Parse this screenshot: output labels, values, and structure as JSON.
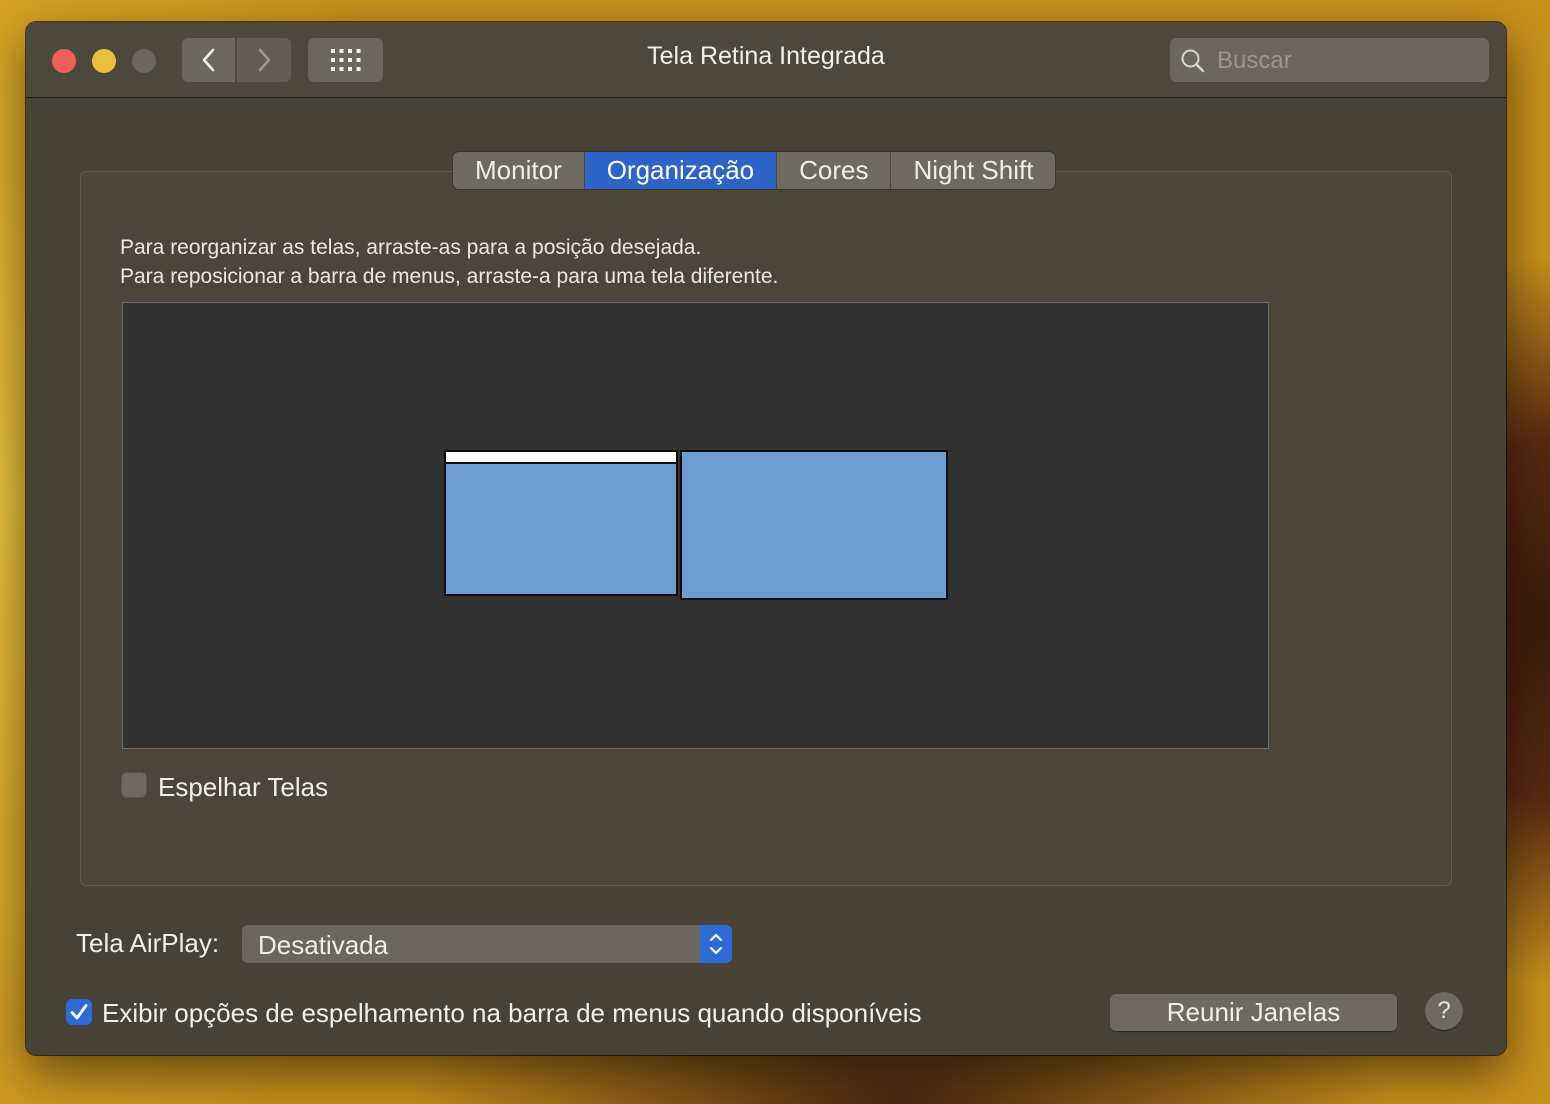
{
  "window": {
    "title": "Tela Retina Integrada",
    "search_placeholder": "Buscar"
  },
  "icons": {
    "back": "chevron-left-icon",
    "forward": "chevron-right-icon",
    "show_all": "grid-icon",
    "search": "magnifier-icon",
    "stepper": "up-down-chevron-icon",
    "checkmark": "checkmark-icon"
  },
  "tabs": [
    {
      "label": "Monitor",
      "active": false
    },
    {
      "label": "Organização",
      "active": true
    },
    {
      "label": "Cores",
      "active": false
    },
    {
      "label": "Night Shift",
      "active": false
    }
  ],
  "arrangement": {
    "instruction_1": "Para reorganizar as telas, arraste-as para a posição desejada.",
    "instruction_2": "Para reposicionar a barra de menus, arraste-a para uma tela diferente.",
    "displays": [
      {
        "name": "primary-display",
        "has_menu_bar": true
      },
      {
        "name": "secondary-display",
        "has_menu_bar": false
      }
    ]
  },
  "mirror": {
    "label": "Espelhar Telas",
    "checked": false
  },
  "airplay": {
    "label": "Tela AirPlay:",
    "value": "Desativada"
  },
  "show_mirroring": {
    "label": "Exibir opções de espelhamento na barra de menus quando disponíveis",
    "checked": true
  },
  "gather_button": "Reunir Janelas",
  "help_label": "?",
  "colors": {
    "accent": "#2f6ad4",
    "display_fill": "#6f9dd1",
    "window_bg": "#474236"
  }
}
